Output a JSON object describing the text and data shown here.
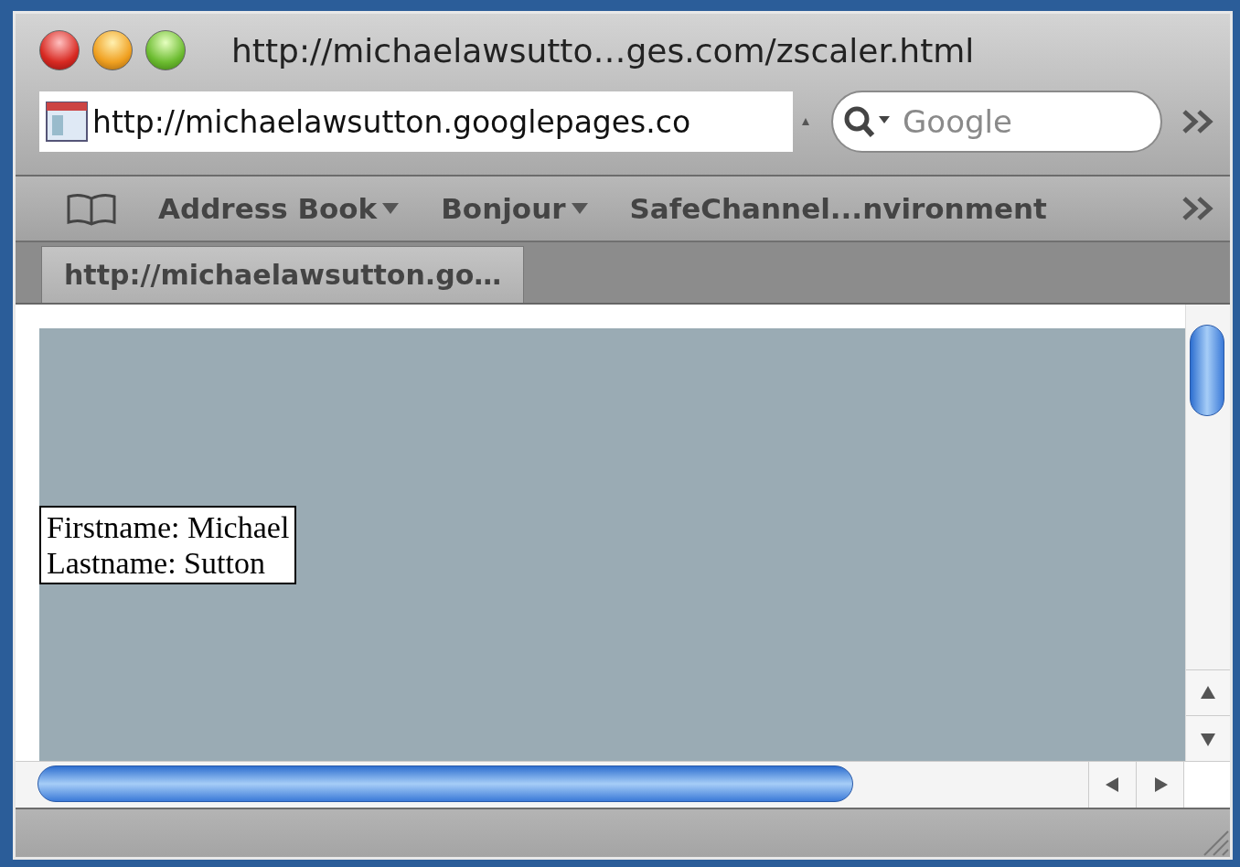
{
  "window": {
    "title": "http://michaelawsutto…ges.com/zscaler.html"
  },
  "address_bar": {
    "value": "http://michaelawsutton.googlepages.co"
  },
  "search": {
    "placeholder": "Google"
  },
  "bookmarks": [
    {
      "label": "Address Book",
      "kind": "menu"
    },
    {
      "label": "Bonjour",
      "kind": "menu"
    },
    {
      "label": "SafeChannel...nvironment",
      "kind": "link"
    }
  ],
  "tabs": [
    {
      "label": "http://michaelawsutton.go…",
      "selected": true
    }
  ],
  "page": {
    "lines": [
      "Firstname: Michael",
      "Lastname: Sutton"
    ]
  }
}
